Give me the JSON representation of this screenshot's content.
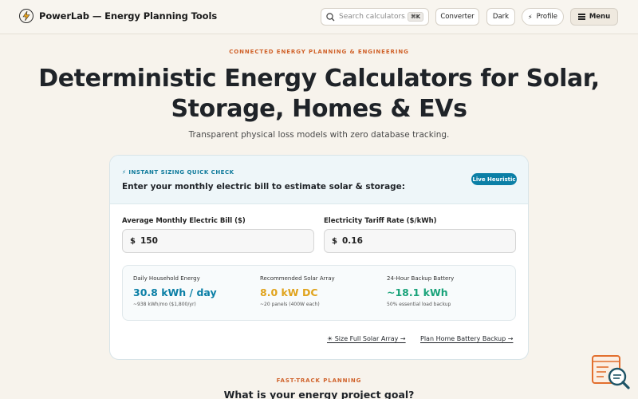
{
  "header": {
    "brand_title": "PowerLab — Energy Planning Tools",
    "search_placeholder": "Search calculators...",
    "search_shortcut": "⌘K",
    "converter_label": "Converter",
    "dark_label": "Dark",
    "profile_icon": "⚡",
    "profile_label": "Profile",
    "menu_label": "Menu"
  },
  "hero": {
    "eyebrow": "CONNECTED ENERGY PLANNING & ENGINEERING",
    "title_line1": "Deterministic Energy Calculators for Solar,",
    "title_line2": "Storage, Homes & EVs",
    "subtitle": "Transparent physical loss models with zero database tracking."
  },
  "card": {
    "quick_label": "⚡ INSTANT SIZING QUICK CHECK",
    "title": "Enter your monthly electric bill to estimate solar & storage:",
    "badge": "Live Heuristic",
    "bill_label": "Average Monthly Electric Bill ($)",
    "bill_currency": "$",
    "bill_value": "150",
    "rate_label": "Electricity Tariff Rate ($/kWh)",
    "rate_currency": "$",
    "rate_value": "0.16",
    "results": [
      {
        "label": "Daily Household Energy",
        "value": "30.8 kWh / day",
        "note": "~938 kWh/mo ($1,800/yr)",
        "color": "#0b7fa6"
      },
      {
        "label": "Recommended Solar Array",
        "value": "8.0 kW DC",
        "note": "~20 panels (400W each)",
        "color": "#e0a31c"
      },
      {
        "label": "24-Hour Backup Battery",
        "value": "~18.1 kWh",
        "note": "50% essential load backup",
        "color": "#1aa37a"
      }
    ],
    "link_solar": "☀ Size Full Solar Array →",
    "link_battery": "Plan Home Battery Backup →"
  },
  "fast_track": {
    "eyebrow": "FAST-TRACK PLANNING",
    "title": "What is your energy project goal?"
  },
  "colors": {
    "accent_orange": "#d0622a",
    "accent_teal": "#0b7fa6",
    "solar_yellow": "#e0a31c",
    "battery_green": "#1aa37a"
  }
}
